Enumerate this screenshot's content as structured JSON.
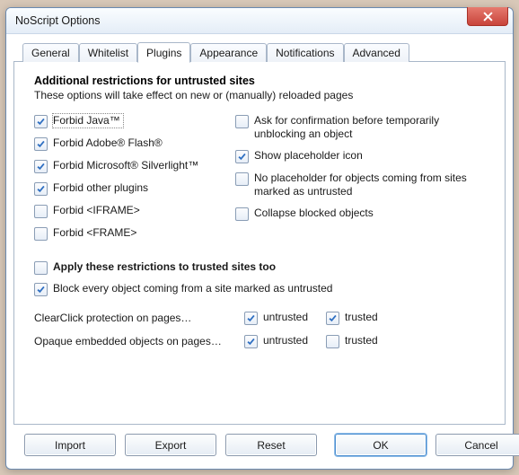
{
  "window": {
    "title": "NoScript Options"
  },
  "tabs": [
    {
      "label": "General"
    },
    {
      "label": "Whitelist"
    },
    {
      "label": "Plugins"
    },
    {
      "label": "Appearance"
    },
    {
      "label": "Notifications"
    },
    {
      "label": "Advanced"
    }
  ],
  "activeTab": 2,
  "plugins": {
    "heading": "Additional restrictions for untrusted sites",
    "subheading": "These options will take effect on new or (manually) reloaded pages",
    "left": [
      {
        "label": "Forbid Java™",
        "checked": true,
        "focused": true
      },
      {
        "label": "Forbid Adobe® Flash®",
        "checked": true
      },
      {
        "label": "Forbid Microsoft® Silverlight™",
        "checked": true
      },
      {
        "label": "Forbid other plugins",
        "checked": true
      },
      {
        "label": "Forbid <IFRAME>",
        "checked": false
      },
      {
        "label": "Forbid <FRAME>",
        "checked": false
      }
    ],
    "right": [
      {
        "label": "Ask for confirmation before temporarily unblocking an object",
        "checked": false,
        "tall": true
      },
      {
        "label": "Show placeholder icon",
        "checked": true
      },
      {
        "label": "No placeholder for objects coming from sites marked as untrusted",
        "checked": false,
        "tall": true
      },
      {
        "label": "Collapse blocked objects",
        "checked": false
      }
    ],
    "applyTrusted": {
      "label": "Apply these restrictions to trusted sites too",
      "checked": false
    },
    "blockUntrusted": {
      "label": "Block every object coming from a site marked as untrusted",
      "checked": true
    },
    "clearclick": {
      "label": "ClearClick protection on pages…",
      "untrusted": {
        "label": "untrusted",
        "checked": true
      },
      "trusted": {
        "label": "trusted",
        "checked": true
      }
    },
    "opaque": {
      "label": "Opaque embedded objects on pages…",
      "untrusted": {
        "label": "untrusted",
        "checked": true
      },
      "trusted": {
        "label": "trusted",
        "checked": false
      }
    }
  },
  "buttons": {
    "import": "Import",
    "export": "Export",
    "reset": "Reset",
    "ok": "OK",
    "cancel": "Cancel"
  }
}
